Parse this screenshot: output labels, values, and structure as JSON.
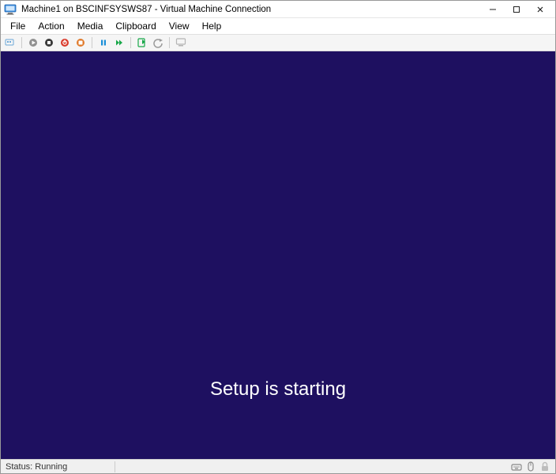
{
  "titlebar": {
    "title": "Machine1 on BSCINFSYSWS87 - Virtual Machine Connection"
  },
  "menu": {
    "file": "File",
    "action": "Action",
    "media": "Media",
    "clipboard": "Clipboard",
    "view": "View",
    "help": "Help"
  },
  "vm": {
    "setup_message": "Setup is starting"
  },
  "statusbar": {
    "status": "Status: Running"
  }
}
